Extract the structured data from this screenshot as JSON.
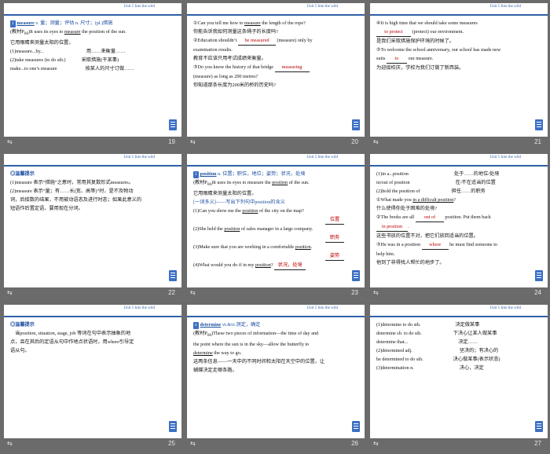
{
  "unit_label": "Unit 5  Into the wild",
  "slides": [
    {
      "page": "19",
      "lines": [
        {
          "html": "<span class='tag'>2</span><span class='b blue ul'>measure</span> <span class='blue'>v. 量；测量；评估 n. 尺寸；(pl.)措施</span>"
        },
        {
          "html": "(教材P<sub>60</sub>)It uses its eyes to <span class='ul'>measure</span> the position of the sun."
        },
        {
          "html": "它用眼睛来测量太阳的位置。"
        },
        {
          "html": "(1)measure...by...<span class='gap'></span>用……来衡量……"
        },
        {
          "html": "(2)take measures (to do sth.)<span style='display:inline-block;width:20px'></span>采取措施(干某事)"
        },
        {
          "html": "make...to one’s measure<span style='display:inline-block;width:36px'></span>按某人的尺寸订做……"
        }
      ]
    },
    {
      "page": "20",
      "lines": [
        {
          "html": "①Can you tell me how to <span class='ul'>measure</span> the length of the rope?"
        },
        {
          "html": "你能告诉我如何测量这条绳子的长度吗?"
        },
        {
          "html": "②Education shouldn’t <span class='blank' style='width:48px'>be measured</span> (measure) only by"
        },
        {
          "html": "examination results."
        },
        {
          "html": "教育不应该只用考试成绩来衡量。"
        },
        {
          "html": "③Do you know the history of that bridge <span class='blank' style='width:44px'>measuring</span>"
        },
        {
          "html": "(measure) as long as 200 metres?"
        },
        {
          "html": "你知道那条长度为200米的桥的历史吗?"
        }
      ]
    },
    {
      "page": "21",
      "lines": [
        {
          "html": "④It is high time that we should take some measures"
        },
        {
          "html": "<span class='blank' style='width:44px'>to protect</span> (protect) our environment."
        },
        {
          "html": "是我们采取措施保护环境的时候了。"
        },
        {
          "html": "⑤To welcome the school anniversary, our school has made new"
        },
        {
          "html": "suits <span class='blank' style='width:26px'>to</span> our measure."
        },
        {
          "html": "为迎接校庆，学校为我们订做了新西装。"
        }
      ]
    },
    {
      "page": "22",
      "lines": [
        {
          "html": "<span class='blue b'>◎温馨提示</span>"
        },
        {
          "html": "(1)measure 表示“措施”之意时，常用其复数形式measures。"
        },
        {
          "html": "(2)measure 表示“量；有……长(宽、高等)”时，是不及物动"
        },
        {
          "html": "词，后接数的结果，不用被动语态及进行时态；如果此意义的"
        },
        {
          "html": "短语作后置定语，要用现在分词。"
        }
      ]
    },
    {
      "page": "23",
      "lines": [
        {
          "html": "<span class='tag'>3</span><span class='b blue ul'>position</span> <span class='blue'>n. 位置；职位，地位；姿势；状况，处境</span>"
        },
        {
          "html": "(教材P<sub>60</sub>)It uses its eyes to measure the <span class='ul'>position</span> of the sun."
        },
        {
          "html": "它用眼睛来测量太阳的位置。"
        },
        {
          "html": "<span class='blue'>[一词多义]——写出下列句中position的含义</span>"
        },
        {
          "html": "(1)Can you show me the <span class='ul'>position</span> of the city on the map?"
        },
        {
          "html": "<span style='display:inline-block;width:168px'></span><span class='blank' style='width:24px'>位置</span>"
        },
        {
          "html": "(2)She held the <span class='ul'>position</span> of sales manager in a large company."
        },
        {
          "html": "<span style='display:inline-block;width:168px'></span><span class='blank' style='width:24px'>职务</span>"
        },
        {
          "html": "(3)Make sure that you are working in a comfortable <span class='ul'>position</span>."
        },
        {
          "html": "<span style='display:inline-block;width:168px'></span><span class='blank' style='width:24px'>姿势</span>"
        },
        {
          "html": "(4)What would you do if in my <span class='ul'>position</span>? <span class='blank' style='width:40px'>状况，处境</span>"
        }
      ]
    },
    {
      "page": "24",
      "lines": [
        {
          "html": "(1)in a...position<span class='tab2' style='width:58px'></span>处于……的地位/处境"
        },
        {
          "html": "in/out of position<span style='display:inline-block;width:58px'></span>在/不在适当的位置"
        },
        {
          "html": "(2)hold the position of<span style='display:inline-block;width:40px'></span>担任……的职务"
        },
        {
          "html": "①What made you <span class='ul'>in a difficult position</span>?"
        },
        {
          "html": "什么使得你处于困难的处境?"
        },
        {
          "html": "②The books are all <span class='blank' style='width:36px'>out of</span> position. Put them back"
        },
        {
          "html": "<span class='blank' style='width:40px'>in position</span>."
        },
        {
          "html": "这些书放的位置不对，把它们放回适当的位置。"
        },
        {
          "html": "③He was in a position <span class='blank' style='width:34px'>where</span> he must find someone to"
        },
        {
          "html": "help him."
        },
        {
          "html": "他到了非得找人帮忙的地步了。"
        }
      ]
    },
    {
      "page": "25",
      "lines": [
        {
          "html": "<span class='blue b'>◎温馨提示</span>"
        },
        {
          "html": "　当position, situation, stage, job 等词在句中表示抽象的地"
        },
        {
          "html": "点，且在其后的定语从句中作地点状语时，用where引导定"
        },
        {
          "html": "语从句。"
        }
      ]
    },
    {
      "page": "26",
      "lines": [
        {
          "html": "<span class='tag'>4</span><span class='b blue ul'>determine</span> <span class='blue'>vt.&amp;vi.测定，确定</span>"
        },
        {
          "html": "(教材P<sub>60</sub>)These two pieces of information—the time of day and"
        },
        {
          "html": "the point where the sun is in the sky—allow the butterfly to"
        },
        {
          "html": "<span class='ul'>determine</span> the way to go."
        },
        {
          "html": "这两条信息——一天中的不同时间和太阳在天空中的位置，让"
        },
        {
          "html": "蝴蝶决定走哪条路。"
        }
      ]
    },
    {
      "page": "27",
      "lines": [
        {
          "html": "(1)determine to do sth.<span style='display:inline-block;width:44px'></span>决定做某事"
        },
        {
          "html": "determine sb. to do sth.<span style='display:inline-block;width:40px'></span>下决心让某人做某事"
        },
        {
          "html": "determine that...<span style='display:inline-block;width:64px'></span>决定……"
        },
        {
          "html": "(2)determined adj.<span style='display:inline-block;width:60px'></span>坚决的；有决心的"
        },
        {
          "html": "be determined to do sth.<span style='display:inline-block;width:38px'></span>决心做某事(表示状态)"
        },
        {
          "html": "(3)determination n.<span style='display:inline-block;width:58px'></span>决心，决定"
        }
      ]
    }
  ]
}
